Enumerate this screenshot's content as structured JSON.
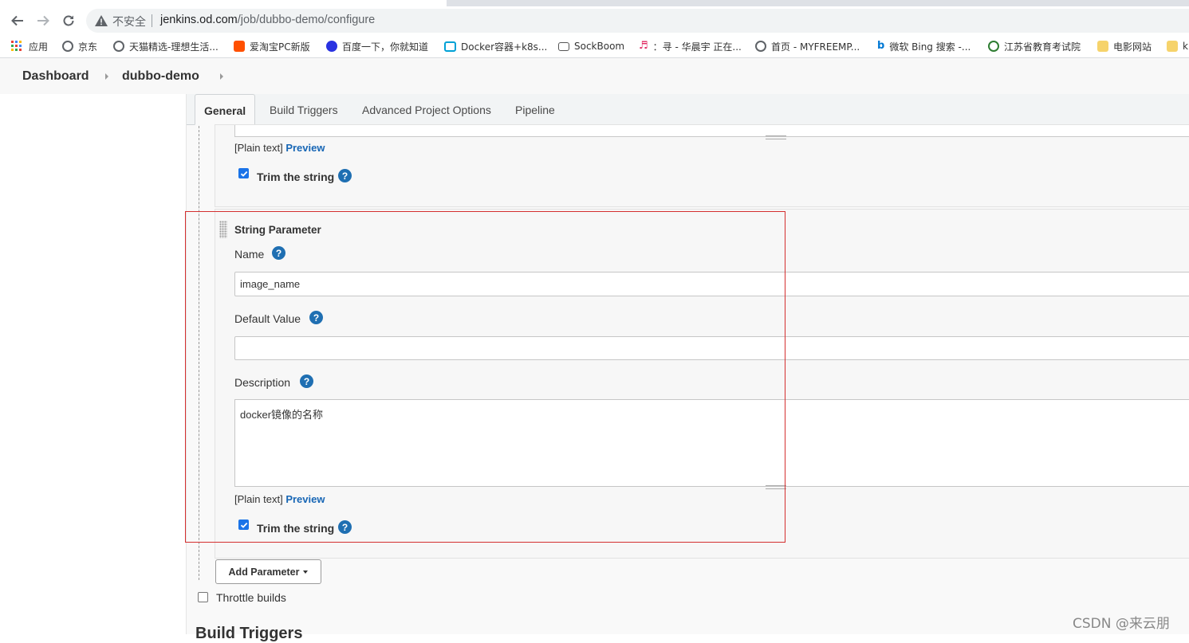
{
  "browser": {
    "security_label": "不安全",
    "url_host": "jenkins.od.com",
    "url_path": "/job/dubbo-demo/configure"
  },
  "bookmarks": [
    {
      "label": "应用",
      "icon": "apps-grid-icon",
      "color": "#e94235"
    },
    {
      "label": "京东",
      "icon": "globe-icon",
      "color": "#5f6368"
    },
    {
      "label": "天猫精选-理想生活...",
      "icon": "globe-icon",
      "color": "#5f6368"
    },
    {
      "label": "爱淘宝PC新版",
      "icon": "taobao-icon",
      "color": "#ff5000"
    },
    {
      "label": "百度一下，你就知道",
      "icon": "baidu-paw-icon",
      "color": "#2932e1"
    },
    {
      "label": "Docker容器+k8s...",
      "icon": "bilibili-icon",
      "color": "#00a1d6"
    },
    {
      "label": "SockBoom",
      "icon": "sockboom-icon",
      "color": "#555555"
    },
    {
      "label": "：寻 - 华晨宇 正在...",
      "icon": "music-note-icon",
      "color": "#e0245e"
    },
    {
      "label": "首页 - MYFREEMP...",
      "icon": "globe-icon",
      "color": "#5f6368"
    },
    {
      "label": "微软 Bing 搜索 -...",
      "icon": "bing-icon",
      "color": "#0078d4"
    },
    {
      "label": "江苏省教育考试院",
      "icon": "jiangsu-exam-icon",
      "color": "#2e7d32"
    },
    {
      "label": "电影网站",
      "icon": "folder-icon",
      "color": "#f6d36b"
    },
    {
      "label": "k",
      "icon": "folder-icon",
      "color": "#f6d36b"
    }
  ],
  "breadcrumb": {
    "items": [
      "Dashboard",
      "dubbo-demo"
    ]
  },
  "tabs": [
    "General",
    "Build Triggers",
    "Advanced Project Options",
    "Pipeline"
  ],
  "previous_param": {
    "plain_text": "[Plain text]",
    "preview": "Preview",
    "trim_label": "Trim the string",
    "trim_checked": true
  },
  "string_param": {
    "title": "String Parameter",
    "name_label": "Name",
    "name_value": "image_name",
    "default_label": "Default Value",
    "default_value": "",
    "description_label": "Description",
    "description_value": "docker镜像的名称",
    "plain_text": "[Plain text]",
    "preview": "Preview",
    "trim_label": "Trim the string",
    "trim_checked": true
  },
  "help_symbol": "?",
  "add_parameter_label": "Add Parameter",
  "throttle_label": "Throttle builds",
  "build_triggers_heading": "Build Triggers",
  "watermark": "CSDN @来云朋",
  "colors": {
    "link": "#1766b5",
    "help": "#1f6fb2",
    "highlight_box": "#d42f2f"
  }
}
